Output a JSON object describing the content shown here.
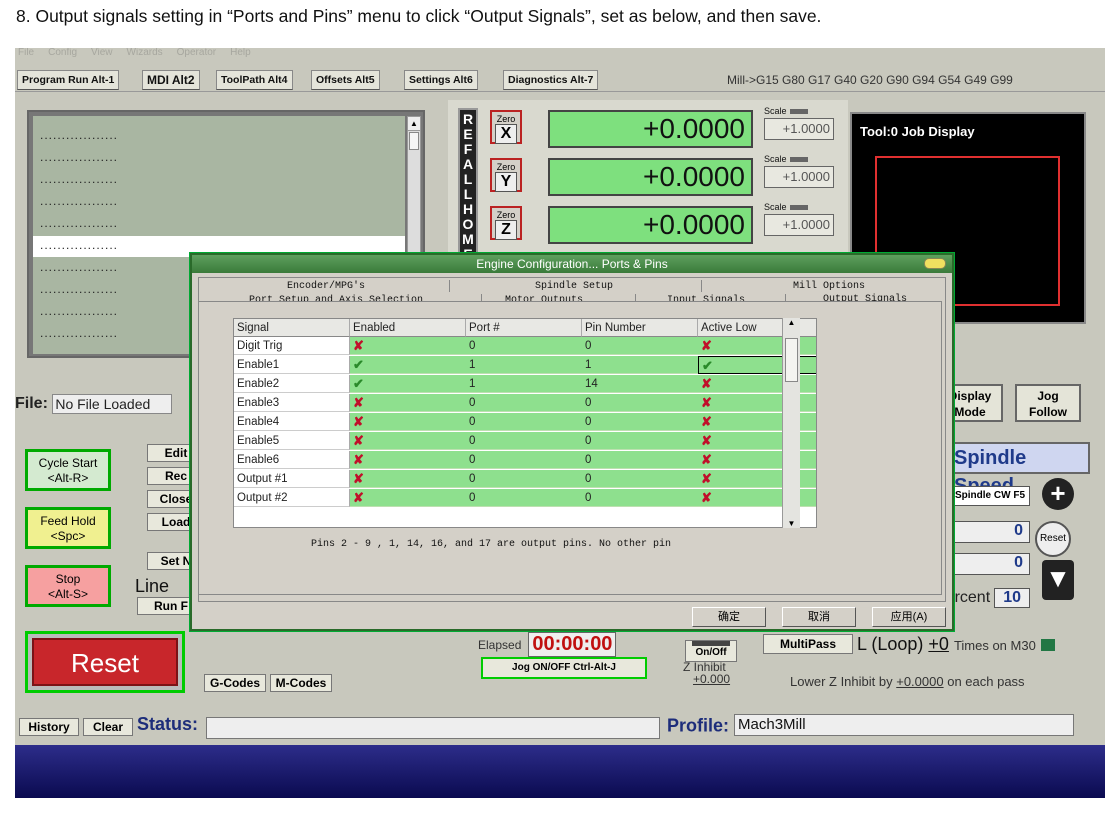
{
  "instruction": "8. Output signals setting in “Ports and Pins” menu to click “Output Signals”, set as below, and then save.",
  "menubar": [
    "File",
    "Config",
    "View",
    "Wizards",
    "Operator",
    "Help"
  ],
  "tabs": [
    "Program Run Alt-1",
    "MDI Alt2",
    "ToolPath Alt4",
    "Offsets Alt5",
    "Settings Alt6",
    "Diagnostics Alt-7"
  ],
  "gcode_modal": "Mill->G15  G80 G17 G40 G20 G90 G94 G54 G49 G99",
  "gcode_lines": [
    "..................",
    "..................",
    "..................",
    "..................",
    "..................",
    "..................",
    "..................",
    "..................",
    "..................",
    ".................."
  ],
  "refall": "REFALLHOME",
  "dro": [
    {
      "axis": "X",
      "zero": "Zero",
      "value": "+0.0000",
      "scale_label": "Scale",
      "scale": "+1.0000"
    },
    {
      "axis": "Y",
      "zero": "Zero",
      "value": "+0.0000",
      "scale_label": "Scale",
      "scale": "+1.0000"
    },
    {
      "axis": "Z",
      "zero": "Zero",
      "value": "+0.0000",
      "scale_label": "Scale",
      "scale": "+1.0000"
    }
  ],
  "job_display": {
    "title": "Tool:0   Job Display"
  },
  "file": {
    "label": "File:",
    "value": "No File Loaded"
  },
  "display_mode": "Display Mode",
  "jog_follow": "Jog Follow",
  "cycle_start": "Cycle Start\n<Alt-R>",
  "feed_hold": "Feed Hold\n<Spc>",
  "stop": "Stop\n<Alt-S>",
  "mid_buttons": [
    "Edit",
    "Rec",
    "Close",
    "Load",
    "Set N",
    "Run F"
  ],
  "line_label": "Line",
  "spindle": {
    "title": "Spindle Speed",
    "cw": "Spindle CW F5",
    "v1": "0",
    "v2": "0",
    "reset": "Reset",
    "ent_label": "Percent",
    "ent": "10"
  },
  "reset": "Reset",
  "gcodes": "G-Codes",
  "mcodes": "M-Codes",
  "elapsed": {
    "label": "Elapsed",
    "value": "00:00:00"
  },
  "jog_onoff": "Jog ON/OFF Ctrl-Alt-J",
  "onoff": "On/Off",
  "z_inhibit": {
    "label": "Z Inhibit",
    "value": "+0.000"
  },
  "multipass": "MultiPass",
  "loop": {
    "label": "L (Loop)",
    "value": "+0",
    "suffix": "Times on M30"
  },
  "lower_z": {
    "label": "Lower Z Inhibit by",
    "value": "+0.0000",
    "suffix": "on each pass"
  },
  "history": "History",
  "clear": "Clear",
  "status_label": "Status:",
  "profile": {
    "label": "Profile:",
    "value": "Mach3Mill"
  },
  "dialog": {
    "title": "Engine Configuration... Ports & Pins",
    "tabs_row1": [
      "Encoder/MPG's",
      "Spindle Setup",
      "Mill Options"
    ],
    "tabs_row2": [
      "Port Setup and Axis Selection",
      "Motor Outputs",
      "Input Signals",
      "Output Signals"
    ],
    "columns": [
      "Signal",
      "Enabled",
      "Port #",
      "Pin Number",
      "Active Low"
    ],
    "rows": [
      {
        "signal": "Digit  Trig",
        "enabled": "✘",
        "port": "0",
        "pin": "0",
        "active_low": "✘"
      },
      {
        "signal": "Enable1",
        "enabled": "✔",
        "port": "1",
        "pin": "1",
        "active_low": "✔"
      },
      {
        "signal": "Enable2",
        "enabled": "✔",
        "port": "1",
        "pin": "14",
        "active_low": "✘"
      },
      {
        "signal": "Enable3",
        "enabled": "✘",
        "port": "0",
        "pin": "0",
        "active_low": "✘"
      },
      {
        "signal": "Enable4",
        "enabled": "✘",
        "port": "0",
        "pin": "0",
        "active_low": "✘"
      },
      {
        "signal": "Enable5",
        "enabled": "✘",
        "port": "0",
        "pin": "0",
        "active_low": "✘"
      },
      {
        "signal": "Enable6",
        "enabled": "✘",
        "port": "0",
        "pin": "0",
        "active_low": "✘"
      },
      {
        "signal": "Output #1",
        "enabled": "✘",
        "port": "0",
        "pin": "0",
        "active_low": "✘"
      },
      {
        "signal": "Output #2",
        "enabled": "✘",
        "port": "0",
        "pin": "0",
        "active_low": "✘"
      }
    ],
    "note": "Pins 2 - 9 , 1, 14, 16, and 17 are output pins. No  other pin",
    "ok": "确定",
    "cancel": "取消",
    "apply": "应用(A)"
  },
  "colors": {
    "dro_green": "#7ee07e",
    "grid_green": "#8ee08e",
    "reset_red": "#c8262b",
    "dialog_title": "#4a8a4a"
  }
}
